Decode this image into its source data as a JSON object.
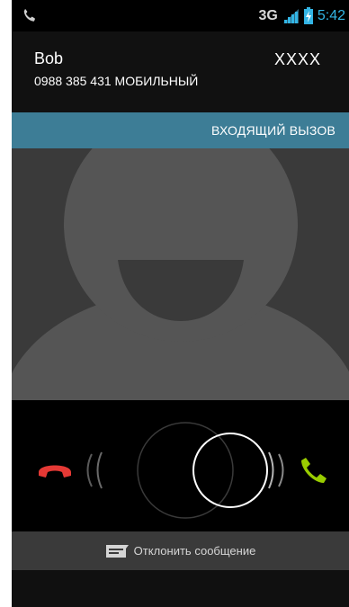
{
  "status_bar": {
    "call_icon": "phone-handset-icon",
    "network_type": "3G",
    "signal_icon": "signal-bars-icon",
    "battery_icon": "battery-charging-icon",
    "time": "5:42",
    "time_color": "#33b5e5"
  },
  "caller": {
    "name": "Bob",
    "number": "0988 385 431",
    "number_type": "МОБИЛЬНЫЙ",
    "carrier": "XXXX"
  },
  "incoming_banner": {
    "label": "ВХОДЯЩИЙ ВЫЗОВ",
    "color": "#3d7d96"
  },
  "avatar": {
    "icon": "default-contact-avatar-icon"
  },
  "glowpad": {
    "decline_icon": "decline-call-icon",
    "decline_color": "#e53935",
    "answer_icon": "answer-call-icon",
    "answer_color": "#99cc00",
    "handle_icon": "drag-handle-ring-icon"
  },
  "reject_with_message": {
    "icon": "message-icon",
    "label": "Отклонить сообщение"
  }
}
